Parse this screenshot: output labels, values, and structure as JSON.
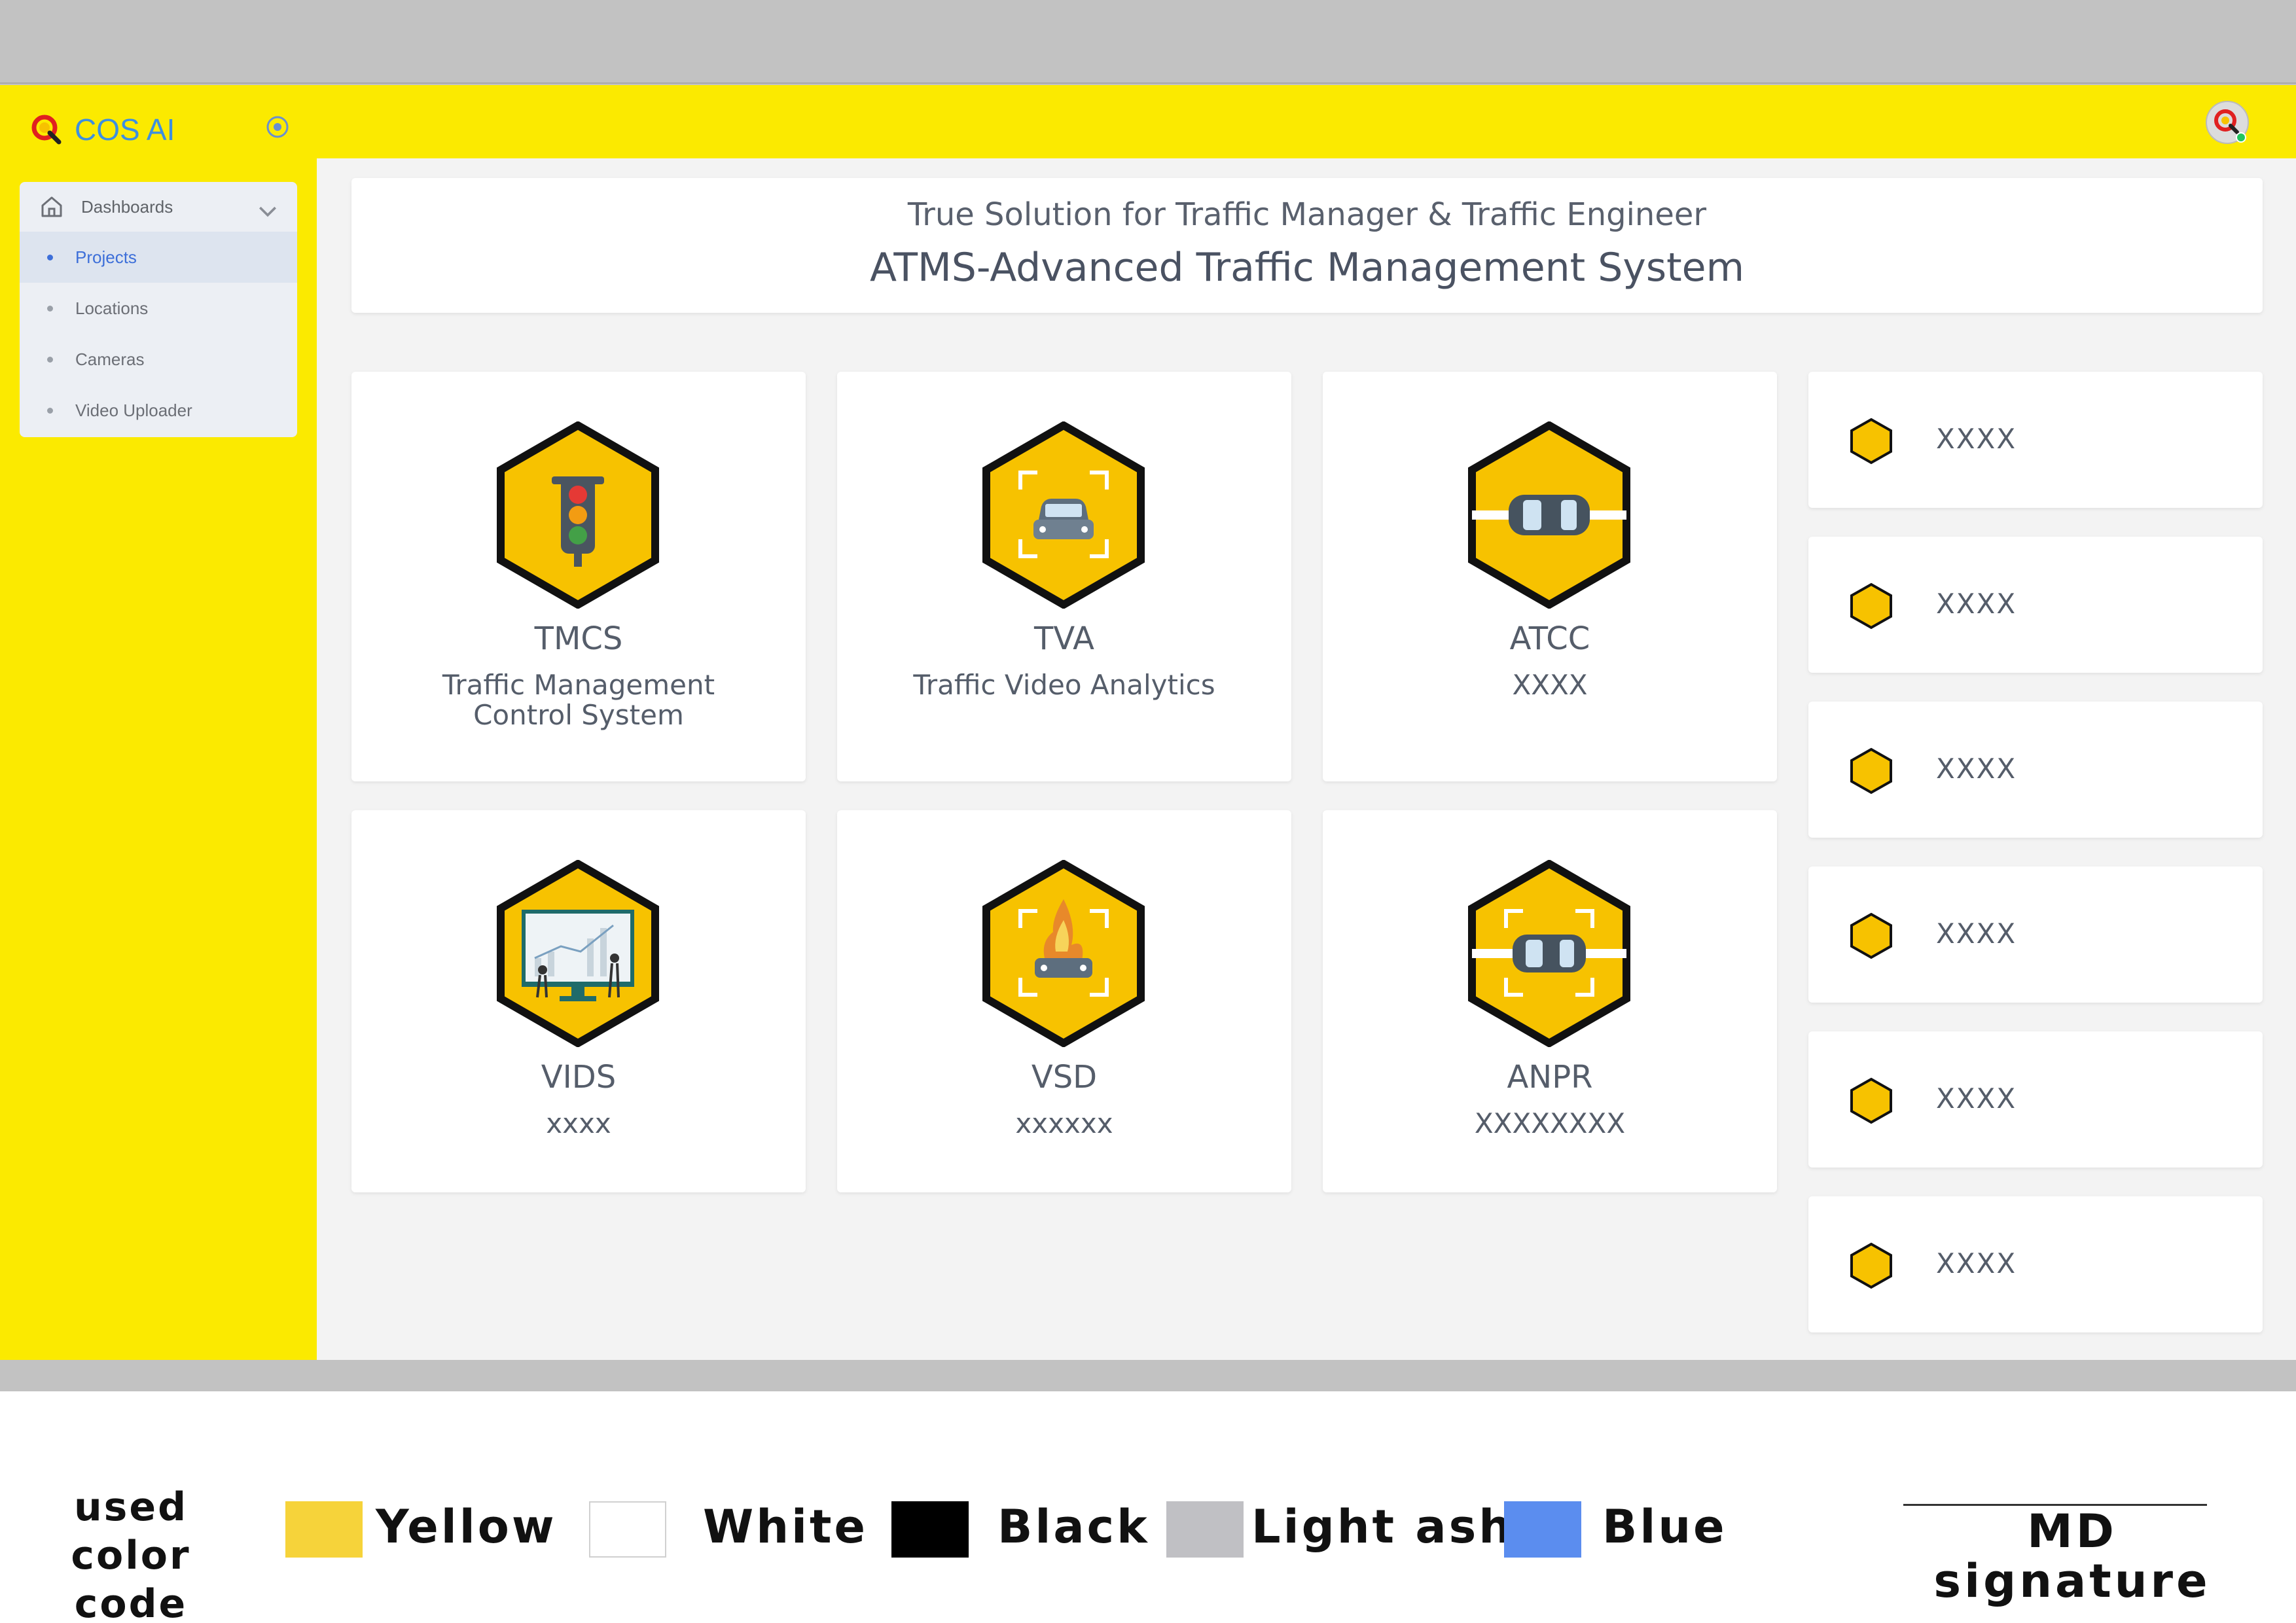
{
  "app": {
    "brand_name": "COS AI"
  },
  "sidebar": {
    "section_label": "Dashboards",
    "items": [
      {
        "label": "Projects",
        "active": true
      },
      {
        "label": "Locations",
        "active": false
      },
      {
        "label": "Cameras",
        "active": false
      },
      {
        "label": "Video Uploader",
        "active": false
      }
    ]
  },
  "header": {
    "subtitle": "True Solution for Traffic Manager & Traffic Engineer",
    "title": "ATMS-Advanced Traffic Management System"
  },
  "modules": [
    {
      "code": "TMCS",
      "desc_line1": "Traffic Management",
      "desc_line2": "Control System",
      "icon": "traffic-light-icon"
    },
    {
      "code": "TVA",
      "desc_line1": "Traffic Video Analytics",
      "desc_line2": "",
      "icon": "car-focus-icon"
    },
    {
      "code": "ATCC",
      "desc_line1": "XXXX",
      "desc_line2": "",
      "icon": "car-lane-icon"
    },
    {
      "code": "VIDS",
      "desc_line1": "xxxx",
      "desc_line2": "",
      "icon": "analytics-board-icon"
    },
    {
      "code": "VSD",
      "desc_line1": "xxxxxx",
      "desc_line2": "",
      "icon": "car-fire-icon"
    },
    {
      "code": "ANPR",
      "desc_line1": "XXXXXXXX",
      "desc_line2": "",
      "icon": "plate-focus-icon"
    }
  ],
  "side_list": [
    {
      "label": "XXXX"
    },
    {
      "label": "XXXX"
    },
    {
      "label": "XXXX"
    },
    {
      "label": "XXXX"
    },
    {
      "label": "XXXX"
    },
    {
      "label": "XXXX"
    }
  ],
  "legend": {
    "title_line1": "used color",
    "title_line2": "code",
    "colors": [
      {
        "name": "Yellow",
        "hex": "#f6d33a"
      },
      {
        "name": "White",
        "hex": "#ffffff"
      },
      {
        "name": "Black",
        "hex": "#000000"
      },
      {
        "name": "Light ash",
        "hex": "#c0c0c4"
      },
      {
        "name": "Blue",
        "hex": "#5b8def"
      }
    ],
    "signature_line1": "MD",
    "signature_line2": "signature"
  },
  "colors": {
    "accent_yellow": "#fbea00",
    "hex_yellow": "#f7c200",
    "active_blue": "#3d6fd9"
  }
}
